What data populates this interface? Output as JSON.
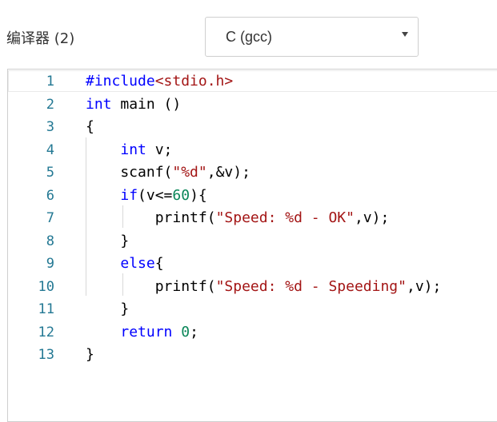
{
  "compiler": {
    "label": "编译器 (2)",
    "selected": "C (gcc)"
  },
  "editor": {
    "lines": [
      {
        "num": "1",
        "tokens": [
          {
            "c": "pp",
            "t": "#include"
          },
          {
            "c": "inc",
            "t": "<stdio.h>"
          }
        ]
      },
      {
        "num": "2",
        "tokens": [
          {
            "c": "kw",
            "t": "int"
          },
          {
            "c": "pl",
            "t": " main ()"
          }
        ]
      },
      {
        "num": "3",
        "tokens": [
          {
            "c": "pl",
            "t": "{"
          }
        ]
      },
      {
        "num": "4",
        "tokens": [
          {
            "c": "pl",
            "t": "    "
          },
          {
            "c": "kw",
            "t": "int"
          },
          {
            "c": "pl",
            "t": " v;"
          }
        ]
      },
      {
        "num": "5",
        "tokens": [
          {
            "c": "pl",
            "t": "    scanf("
          },
          {
            "c": "str",
            "t": "\"%d\""
          },
          {
            "c": "pl",
            "t": ",&v);"
          }
        ]
      },
      {
        "num": "6",
        "tokens": [
          {
            "c": "pl",
            "t": "    "
          },
          {
            "c": "kw",
            "t": "if"
          },
          {
            "c": "pl",
            "t": "(v<="
          },
          {
            "c": "num",
            "t": "60"
          },
          {
            "c": "pl",
            "t": "){"
          }
        ]
      },
      {
        "num": "7",
        "tokens": [
          {
            "c": "pl",
            "t": "        printf("
          },
          {
            "c": "str",
            "t": "\"Speed: %d - OK\""
          },
          {
            "c": "pl",
            "t": ",v);"
          }
        ]
      },
      {
        "num": "8",
        "tokens": [
          {
            "c": "pl",
            "t": "    }"
          }
        ]
      },
      {
        "num": "9",
        "tokens": [
          {
            "c": "pl",
            "t": "    "
          },
          {
            "c": "kw",
            "t": "else"
          },
          {
            "c": "pl",
            "t": "{"
          }
        ]
      },
      {
        "num": "10",
        "tokens": [
          {
            "c": "pl",
            "t": "        printf("
          },
          {
            "c": "str",
            "t": "\"Speed: %d - Speeding\""
          },
          {
            "c": "pl",
            "t": ",v);"
          }
        ]
      },
      {
        "num": "11",
        "tokens": [
          {
            "c": "pl",
            "t": "    }"
          }
        ]
      },
      {
        "num": "12",
        "tokens": [
          {
            "c": "pl",
            "t": "    "
          },
          {
            "c": "kw",
            "t": "return"
          },
          {
            "c": "pl",
            "t": " "
          },
          {
            "c": "num",
            "t": "0"
          },
          {
            "c": "pl",
            "t": ";"
          }
        ]
      },
      {
        "num": "13",
        "tokens": [
          {
            "c": "pl",
            "t": "}"
          }
        ]
      }
    ]
  }
}
